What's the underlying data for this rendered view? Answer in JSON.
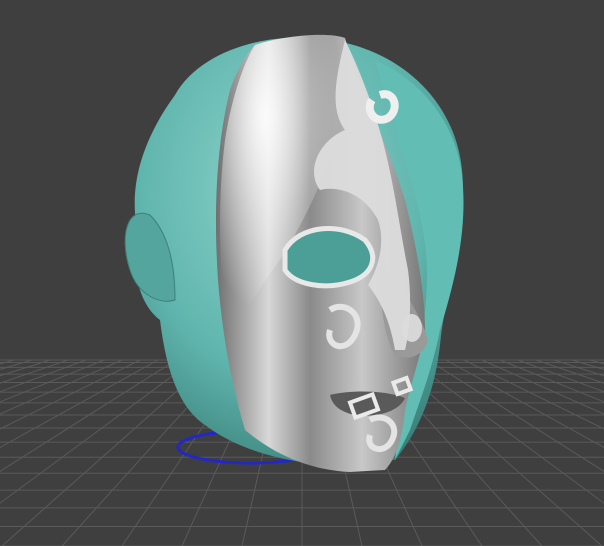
{
  "viewport": {
    "background_color": "#3f3f3f",
    "grid_line_color": "#5a5a5a",
    "grid_visible": true
  },
  "model": {
    "head_skin_color": "#5fb5ad",
    "mask_color": "#bfbfbf",
    "mask_highlight_color": "#f2f2f2",
    "mask_ornament_color": "#dcdcdc",
    "base_ring_color": "#2326c8"
  }
}
